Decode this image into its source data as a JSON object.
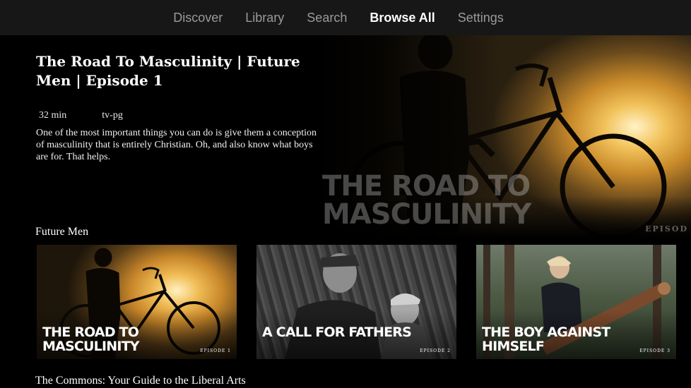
{
  "nav": {
    "items": [
      {
        "label": "Discover",
        "active": false
      },
      {
        "label": "Library",
        "active": false
      },
      {
        "label": "Search",
        "active": false
      },
      {
        "label": "Browse All",
        "active": true
      },
      {
        "label": "Settings",
        "active": false
      }
    ]
  },
  "hero": {
    "title": "The Road To Masculinity | Future Men | Episode 1",
    "duration": "32 min",
    "rating": "tv-pg",
    "description": "One of the most important things you can do is give them a conception of masculinity that is entirely Christian. Oh, and also know what boys are for. That helps.",
    "art_title": "THE ROAD TO MASCULINITY",
    "art_episode": "EPISOD"
  },
  "sections": [
    {
      "title": "Future Men",
      "cards": [
        {
          "title": "THE ROAD TO MASCULINITY",
          "episode": "EPISODE 1"
        },
        {
          "title": "A CALL FOR FATHERS",
          "episode": "EPISODE 2"
        },
        {
          "title": "THE BOY AGAINST HIMSELF",
          "episode": "EPISODE 3"
        }
      ]
    },
    {
      "title": "The Commons: Your Guide to the Liberal Arts"
    }
  ]
}
